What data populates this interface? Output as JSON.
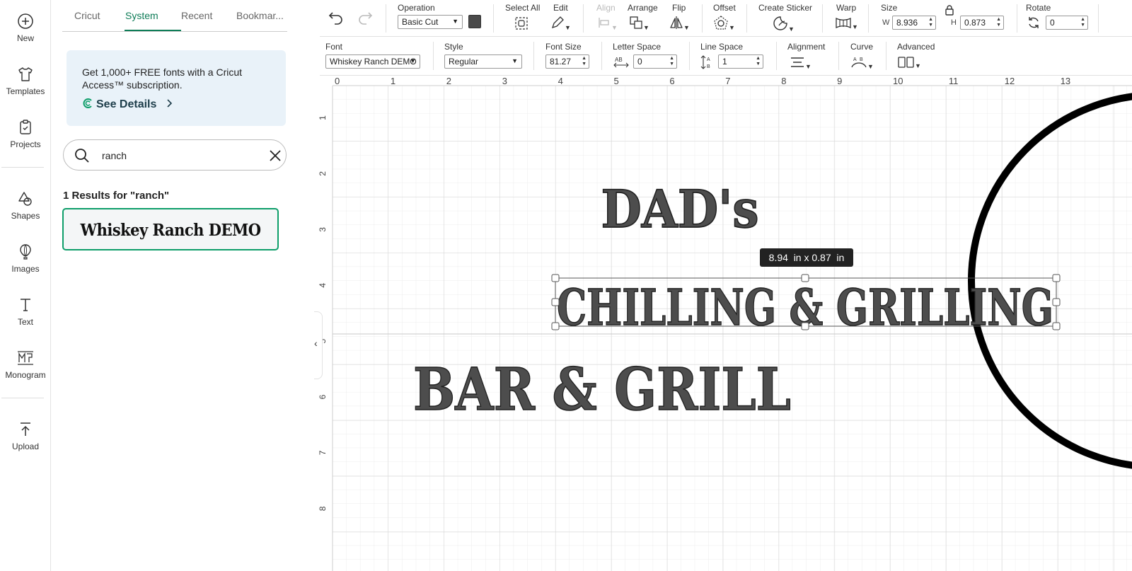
{
  "rail": {
    "new": "New",
    "templates": "Templates",
    "projects": "Projects",
    "shapes": "Shapes",
    "images": "Images",
    "text": "Text",
    "monogram": "Monogram",
    "upload": "Upload"
  },
  "panel": {
    "tabs": [
      "Cricut",
      "System",
      "Recent",
      "Bookmar..."
    ],
    "active_tab": "System",
    "promo_text": "Get 1,000+ FREE fonts with a Cricut Access™ subscription.",
    "promo_link": "See Details",
    "search_value": "ranch",
    "results_label": "1 Results for \"ranch\"",
    "result_font_name": "Whiskey Ranch DEMO"
  },
  "toolbar": {
    "operation_label": "Operation",
    "operation_value": "Basic Cut",
    "operation_color": "#4a4a4a",
    "select_all_label": "Select All",
    "edit_label": "Edit",
    "align_label": "Align",
    "arrange_label": "Arrange",
    "flip_label": "Flip",
    "offset_label": "Offset",
    "create_sticker_label": "Create Sticker",
    "warp_label": "Warp",
    "size_label": "Size",
    "w_label": "W",
    "w_value": "8.936",
    "h_label": "H",
    "h_value": "0.873",
    "rotate_label": "Rotate",
    "rotate_value": "0"
  },
  "text_toolbar": {
    "font_label": "Font",
    "font_value": "Whiskey Ranch DEMO",
    "style_label": "Style",
    "style_value": "Regular",
    "font_size_label": "Font Size",
    "font_size_value": "81.27",
    "letter_space_label": "Letter Space",
    "letter_space_value": "0",
    "line_space_label": "Line Space",
    "line_space_value": "1",
    "alignment_label": "Alignment",
    "curve_label": "Curve",
    "advanced_label": "Advanced"
  },
  "canvas": {
    "ruler_h": [
      "0",
      "1",
      "2",
      "3",
      "4",
      "5",
      "6",
      "7",
      "8",
      "9",
      "10",
      "11",
      "12",
      "13"
    ],
    "ruler_v": [
      "1",
      "2",
      "3",
      "4",
      "5",
      "6",
      "7",
      "8"
    ],
    "text_dads": "DAD's",
    "text_chilling": "CHILLING & GRILLING",
    "text_bar": "BAR & GRILL",
    "size_tooltip": "8.94  in x 0.87  in",
    "text_color": "#4d4d4d"
  },
  "colors": {
    "accent": "#0e7c57",
    "selection_border": "#0e9e6a",
    "promo_bg": "#e9f2f9"
  }
}
